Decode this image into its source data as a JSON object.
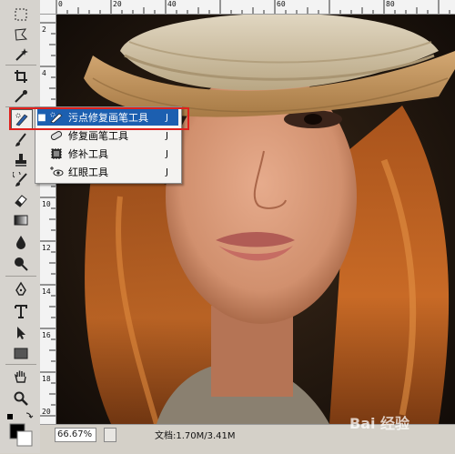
{
  "flyout": {
    "items": [
      {
        "label": "污点修复画笔工具",
        "shortcut": "J",
        "selected": true
      },
      {
        "label": "修复画笔工具",
        "shortcut": "J",
        "selected": false
      },
      {
        "label": "修补工具",
        "shortcut": "J",
        "selected": false
      },
      {
        "label": "红眼工具",
        "shortcut": "J",
        "selected": false
      }
    ]
  },
  "rulers": {
    "top": [
      "0",
      "20",
      "40",
      "60",
      "80"
    ],
    "left": [
      "2",
      "4",
      "6",
      "8",
      "10",
      "12",
      "14",
      "16",
      "18",
      "20"
    ]
  },
  "status": {
    "zoom": "66.67%",
    "doc_info": "文档:1.70M/3.41M"
  },
  "watermark": "Bai 经验",
  "colors": {
    "highlight_box": "#e0201c",
    "menu_selected": "#1c5fb0"
  }
}
